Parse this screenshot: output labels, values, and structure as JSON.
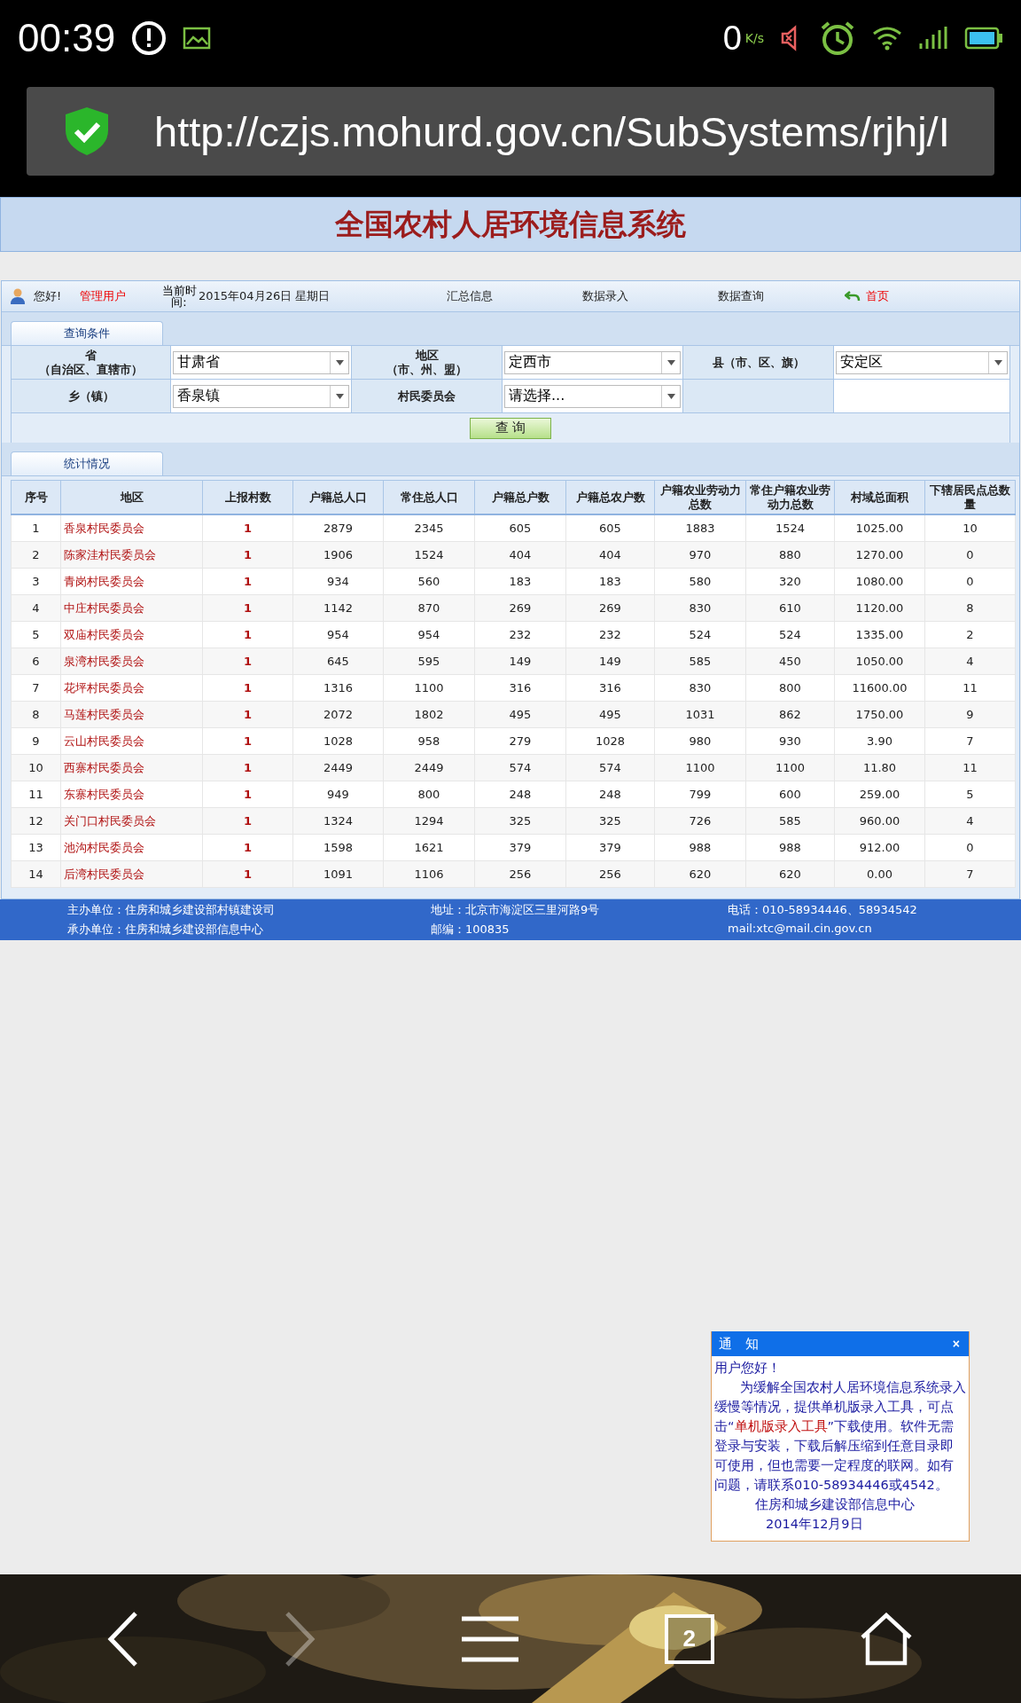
{
  "status_bar": {
    "time": "00:39",
    "speed": "0",
    "speed_unit": "K/s"
  },
  "address_bar": {
    "url": "http://czjs.mohurd.gov.cn/SubSystems/rjhj/I"
  },
  "site_title": "全国农村人居环境信息系统",
  "nav": {
    "greeting": "您好!",
    "user": "管理用户",
    "time_label": "当前时间:",
    "date": "2015年04月26日 星期日",
    "links": [
      "汇总信息",
      "数据录入",
      "数据查询"
    ],
    "home": "首页"
  },
  "query": {
    "tab": "查询条件",
    "fields": [
      {
        "label": [
          "省",
          "（自治区、直辖市）"
        ],
        "value": "甘肃省"
      },
      {
        "label": [
          "地区",
          "（市、州、盟）"
        ],
        "value": "定西市"
      },
      {
        "label": [
          "县（市、区、旗）"
        ],
        "value": "安定区"
      },
      {
        "label": [
          "乡（镇）"
        ],
        "value": "香泉镇"
      },
      {
        "label": [
          "村民委员会"
        ],
        "value": "请选择..."
      }
    ],
    "button": "查 询"
  },
  "stats": {
    "tab": "统计情况",
    "columns": [
      "序号",
      "地区",
      "上报村数",
      "户籍总人口",
      "常住总人口",
      "户籍总户数",
      "户籍总农户数",
      "户籍农业劳动力总数",
      "常住户籍农业劳动力总数",
      "村域总面积",
      "下辖居民点总数量"
    ],
    "rows": [
      [
        "1",
        "香泉村民委员会",
        "1",
        "2879",
        "2345",
        "605",
        "605",
        "1883",
        "1524",
        "1025.00",
        "10"
      ],
      [
        "2",
        "陈家洼村民委员会",
        "1",
        "1906",
        "1524",
        "404",
        "404",
        "970",
        "880",
        "1270.00",
        "0"
      ],
      [
        "3",
        "青岗村民委员会",
        "1",
        "934",
        "560",
        "183",
        "183",
        "580",
        "320",
        "1080.00",
        "0"
      ],
      [
        "4",
        "中庄村民委员会",
        "1",
        "1142",
        "870",
        "269",
        "269",
        "830",
        "610",
        "1120.00",
        "8"
      ],
      [
        "5",
        "双庙村民委员会",
        "1",
        "954",
        "954",
        "232",
        "232",
        "524",
        "524",
        "1335.00",
        "2"
      ],
      [
        "6",
        "泉湾村民委员会",
        "1",
        "645",
        "595",
        "149",
        "149",
        "585",
        "450",
        "1050.00",
        "4"
      ],
      [
        "7",
        "花坪村民委员会",
        "1",
        "1316",
        "1100",
        "316",
        "316",
        "830",
        "800",
        "11600.00",
        "11"
      ],
      [
        "8",
        "马莲村民委员会",
        "1",
        "2072",
        "1802",
        "495",
        "495",
        "1031",
        "862",
        "1750.00",
        "9"
      ],
      [
        "9",
        "云山村民委员会",
        "1",
        "1028",
        "958",
        "279",
        "1028",
        "980",
        "930",
        "3.90",
        "7"
      ],
      [
        "10",
        "西寨村民委员会",
        "1",
        "2449",
        "2449",
        "574",
        "574",
        "1100",
        "1100",
        "11.80",
        "11"
      ],
      [
        "11",
        "东寨村民委员会",
        "1",
        "949",
        "800",
        "248",
        "248",
        "799",
        "600",
        "259.00",
        "5"
      ],
      [
        "12",
        "关门口村民委员会",
        "1",
        "1324",
        "1294",
        "325",
        "325",
        "726",
        "585",
        "960.00",
        "4"
      ],
      [
        "13",
        "池沟村民委员会",
        "1",
        "1598",
        "1621",
        "379",
        "379",
        "988",
        "988",
        "912.00",
        "0"
      ],
      [
        "14",
        "后湾村民委员会",
        "1",
        "1091",
        "1106",
        "256",
        "256",
        "620",
        "620",
        "0.00",
        "7"
      ]
    ]
  },
  "footer": [
    [
      "主办单位：住房和城乡建设部村镇建设司",
      "地址：北京市海淀区三里河路9号",
      "电话：010-58934446、58934542"
    ],
    [
      "承办单位：住房和城乡建设部信息中心",
      "邮编：100835",
      "mail:xtc@mail.cin.gov.cn"
    ]
  ],
  "notice": {
    "title": "通　知",
    "close": "×",
    "greeting": "用户您好！",
    "before": "为缓解全国农村人居环境信息系统录入缓慢等情况，提供单机版录入工具，可点击“",
    "link": "单机版录入工具",
    "after": "”下载使用。软件无需登录与安装，下载后解压缩到任意目录即可使用，但也需要一定程度的联网。如有问题，请联系010-58934446或4542。",
    "signature": "住房和城乡建设部信息中心",
    "date": "2014年12月9日"
  },
  "bottom_nav": {
    "tab_count": "2",
    "forward_disabled": true
  }
}
